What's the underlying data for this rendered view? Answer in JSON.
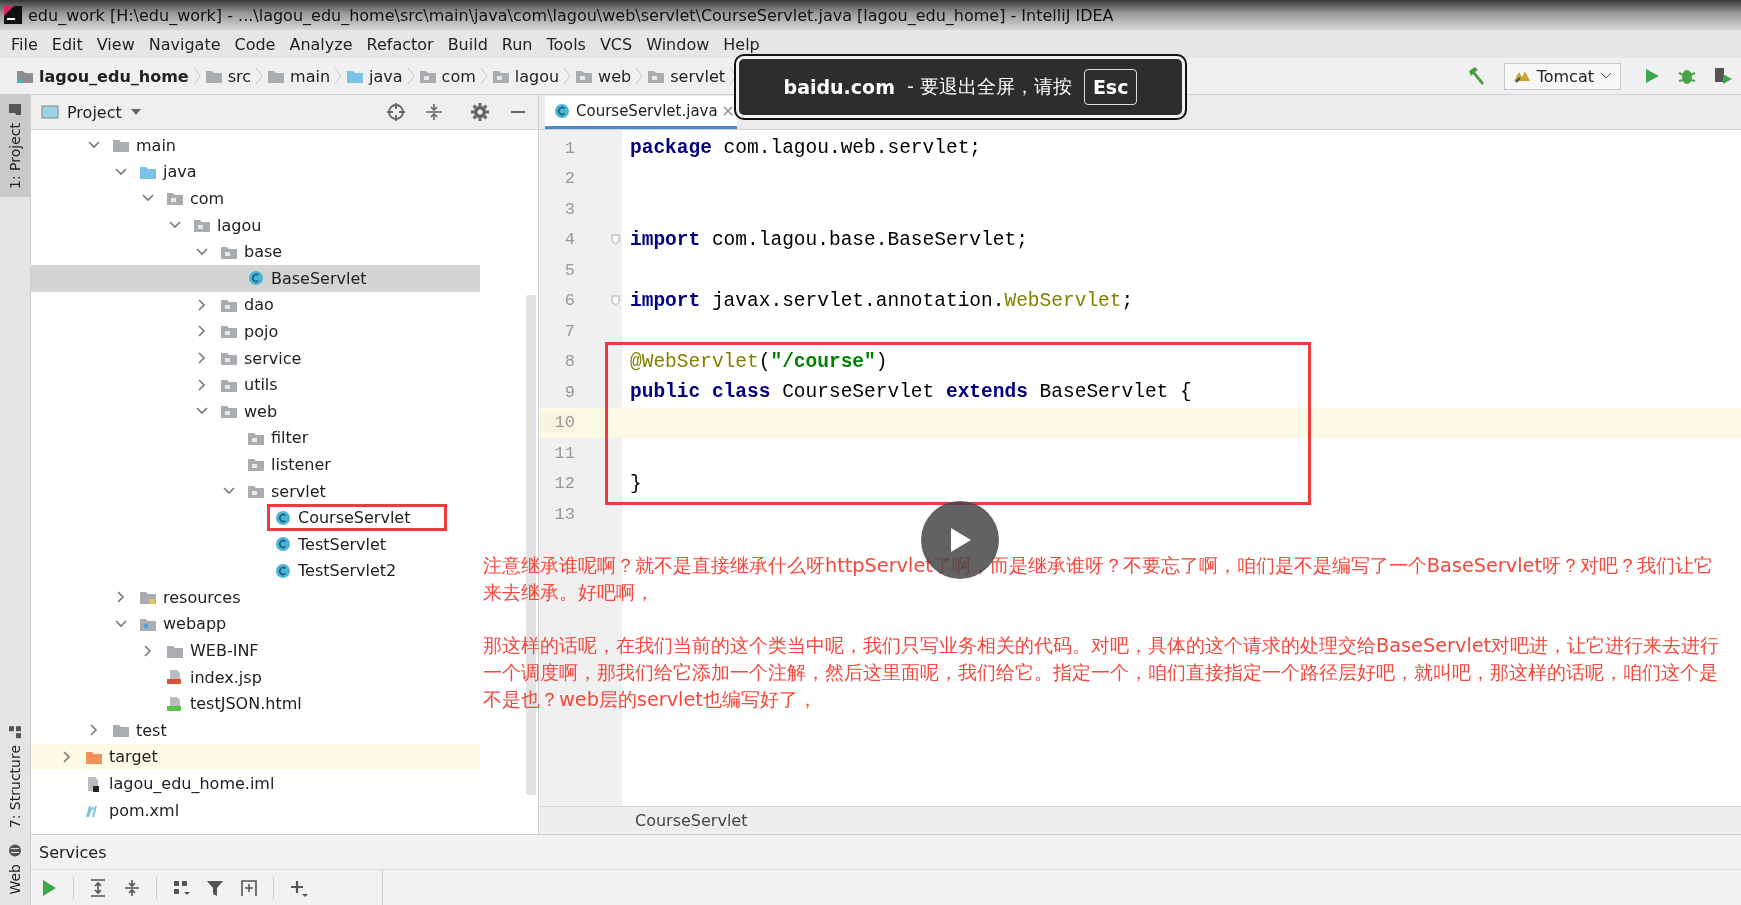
{
  "window": {
    "title": "edu_work [H:\\edu_work] - ...\\lagou_edu_home\\src\\main\\java\\com\\lagou\\web\\servlet\\CourseServlet.java [lagou_edu_home] - IntelliJ IDEA"
  },
  "menu": [
    "File",
    "Edit",
    "View",
    "Navigate",
    "Code",
    "Analyze",
    "Refactor",
    "Build",
    "Run",
    "Tools",
    "VCS",
    "Window",
    "Help"
  ],
  "navbar": {
    "breadcrumbs": [
      {
        "label": "lagou_edu_home",
        "kind": "module"
      },
      {
        "label": "src",
        "kind": "folder"
      },
      {
        "label": "main",
        "kind": "folder"
      },
      {
        "label": "java",
        "kind": "source-root"
      },
      {
        "label": "com",
        "kind": "package"
      },
      {
        "label": "lagou",
        "kind": "package"
      },
      {
        "label": "web",
        "kind": "package"
      },
      {
        "label": "servlet",
        "kind": "package"
      }
    ],
    "run_config": "Tomcat"
  },
  "tool_strip": [
    {
      "label": "1: Project",
      "selected": true
    },
    {
      "label": "7: Structure",
      "selected": false
    },
    {
      "label": "Web",
      "selected": false
    }
  ],
  "project_panel": {
    "title": "Project",
    "tree": [
      {
        "children": [
          {
            "label": "main",
            "kind": "folder",
            "expanded": true,
            "selected": false,
            "children": [
              {
                "label": "java",
                "kind": "source-root",
                "expanded": true,
                "selected": false,
                "children": [
                  {
                    "label": "com",
                    "kind": "package",
                    "expanded": true,
                    "selected": false,
                    "children": [
                      {
                        "label": "lagou",
                        "kind": "package",
                        "expanded": true,
                        "selected": false,
                        "children": [
                          {
                            "label": "base",
                            "kind": "package",
                            "expanded": true,
                            "selected": false,
                            "children": [
                              {
                                "label": "BaseServlet",
                                "kind": "class",
                                "selected": true
                              }
                            ]
                          },
                          {
                            "label": "dao",
                            "kind": "package",
                            "expanded": false,
                            "selected": false
                          },
                          {
                            "label": "pojo",
                            "kind": "package",
                            "expanded": false,
                            "selected": false
                          },
                          {
                            "label": "service",
                            "kind": "package",
                            "expanded": false,
                            "selected": false
                          },
                          {
                            "label": "utils",
                            "kind": "package",
                            "expanded": false,
                            "selected": false
                          },
                          {
                            "label": "web",
                            "kind": "package",
                            "expanded": true,
                            "selected": false,
                            "children": [
                              {
                                "label": "filter",
                                "kind": "package",
                                "selected": false
                              },
                              {
                                "label": "listener",
                                "kind": "package",
                                "selected": false
                              },
                              {
                                "label": "servlet",
                                "kind": "package",
                                "expanded": true,
                                "selected": false,
                                "children": [
                                  {
                                    "label": "CourseServlet",
                                    "kind": "class",
                                    "selected": false,
                                    "outlined": true
                                  },
                                  {
                                    "label": "TestServlet",
                                    "kind": "class",
                                    "selected": false
                                  },
                                  {
                                    "label": "TestServlet2",
                                    "kind": "class",
                                    "selected": false
                                  }
                                ]
                              }
                            ]
                          }
                        ]
                      }
                    ]
                  }
                ]
              },
              {
                "label": "resources",
                "kind": "resources-root",
                "expanded": false,
                "selected": false
              },
              {
                "label": "webapp",
                "kind": "web-root",
                "expanded": true,
                "selected": false,
                "children": [
                  {
                    "label": "WEB-INF",
                    "kind": "folder",
                    "expanded": false,
                    "selected": false
                  },
                  {
                    "label": "index.jsp",
                    "kind": "jsp",
                    "selected": false
                  },
                  {
                    "label": "testJSON.html",
                    "kind": "html",
                    "selected": false
                  }
                ]
              }
            ]
          },
          {
            "label": "test",
            "kind": "folder",
            "expanded": false,
            "selected": false
          }
        ]
      },
      {
        "label": "target",
        "kind": "excluded",
        "expanded": false,
        "selected": false
      },
      {
        "label": "lagou_edu_home.iml",
        "kind": "iml",
        "selected": false
      },
      {
        "label": "pom.xml",
        "kind": "maven",
        "selected": false
      }
    ]
  },
  "editor": {
    "tabs": [
      {
        "label": "CourseServlet.java",
        "selected": true
      }
    ],
    "lines": [
      {
        "number": "1",
        "current": false,
        "boxed": false,
        "fold": false,
        "tokens": [
          {
            "text": "package",
            "kind": "keyword"
          },
          {
            "text": " com.lagou.web.servlet;",
            "kind": "plain"
          }
        ]
      },
      {
        "number": "2",
        "current": false,
        "boxed": false,
        "fold": false
      },
      {
        "number": "3",
        "current": false,
        "boxed": false,
        "fold": false
      },
      {
        "number": "4",
        "current": false,
        "boxed": false,
        "fold": true,
        "tokens": [
          {
            "text": "import",
            "kind": "keyword"
          },
          {
            "text": " com.lagou.base.BaseServlet;",
            "kind": "plain"
          }
        ]
      },
      {
        "number": "5",
        "current": false,
        "boxed": false,
        "fold": false
      },
      {
        "number": "6",
        "current": false,
        "boxed": false,
        "fold": true,
        "tokens": [
          {
            "text": "import",
            "kind": "keyword"
          },
          {
            "text": " javax.servlet.annotation.",
            "kind": "plain"
          },
          {
            "text": "WebServlet",
            "kind": "annotation"
          },
          {
            "text": ";",
            "kind": "plain"
          }
        ]
      },
      {
        "number": "7",
        "current": false,
        "boxed": false,
        "fold": false
      },
      {
        "number": "8",
        "current": false,
        "boxed": true,
        "fold": false,
        "tokens": [
          {
            "text": "@WebServlet",
            "kind": "annotation"
          },
          {
            "text": "(",
            "kind": "plain"
          },
          {
            "text": "\"/course\"",
            "kind": "string"
          },
          {
            "text": ")",
            "kind": "plain"
          }
        ]
      },
      {
        "number": "9",
        "current": false,
        "boxed": true,
        "fold": false,
        "tokens": [
          {
            "text": "public class",
            "kind": "keyword"
          },
          {
            "text": " CourseServlet ",
            "kind": "plain"
          },
          {
            "text": "extends",
            "kind": "keyword"
          },
          {
            "text": " BaseServlet {",
            "kind": "plain"
          }
        ]
      },
      {
        "number": "10",
        "current": true,
        "boxed": true,
        "fold": false
      },
      {
        "number": "11",
        "current": false,
        "boxed": true,
        "fold": false
      },
      {
        "number": "12",
        "current": false,
        "boxed": true,
        "fold": false,
        "tokens": [
          {
            "text": "}",
            "kind": "plain"
          }
        ]
      },
      {
        "number": "13",
        "current": false,
        "boxed": false,
        "fold": false
      }
    ],
    "breadcrumb": "CourseServlet"
  },
  "services": {
    "title": "Services"
  },
  "fullscreen_toast": {
    "domain": "baidu.com",
    "message": "-  要退出全屏，请按",
    "key": "Esc"
  },
  "subtitles": [
    "注意继承谁呢啊？就不是直接继承什么呀httpServlet了啊，而是继承谁呀？不要忘了啊，咱们是不是编写了一个BaseServlet呀？对吧？我们让它来去继承。好吧啊，",
    "那这样的话呢，在我们当前的这个类当中呢，我们只写业务相关的代码。对吧，具体的这个请求的处理交给BaseServlet对吧进，让它进行来去进行一个调度啊，那我们给它添加一个注解，然后这里面呢，我们给它。指定一个，咱们直接指定一个路径层好吧，就叫吧，那这样的话呢，咱们这个是不是也？web层的servlet也编写好了，"
  ]
}
